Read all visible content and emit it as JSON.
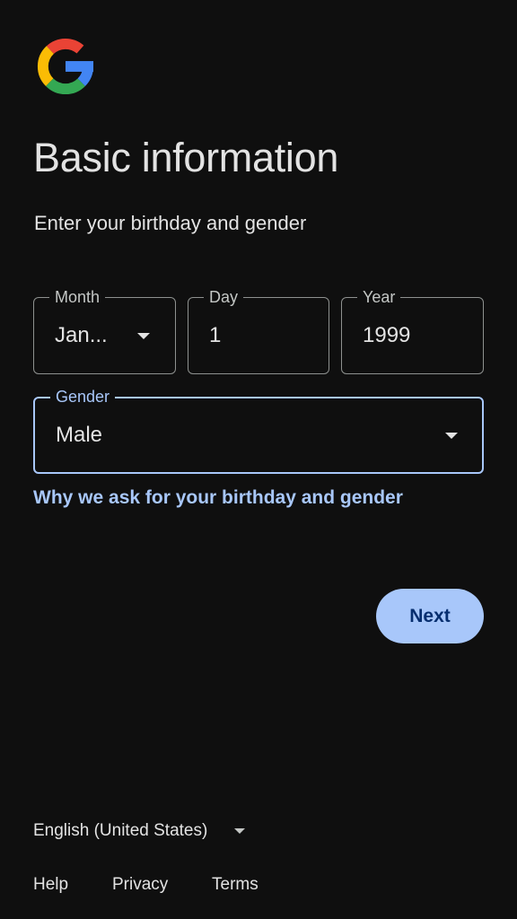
{
  "logo": {
    "icon": "google-g-icon",
    "colors": {
      "blue": "#4285F4",
      "red": "#EA4335",
      "yellow": "#FBBC05",
      "green": "#34A853"
    }
  },
  "header": {
    "title": "Basic information",
    "subtitle": "Enter your birthday and gender"
  },
  "form": {
    "month": {
      "label": "Month",
      "value": "Jan...",
      "icon": "chevron-down-icon"
    },
    "day": {
      "label": "Day",
      "value": "1"
    },
    "year": {
      "label": "Year",
      "value": "1999"
    },
    "gender": {
      "label": "Gender",
      "value": "Male",
      "icon": "chevron-down-icon"
    },
    "help_link": "Why we ask for your birthday and gender",
    "next_label": "Next"
  },
  "footer": {
    "language": "English (United States)",
    "language_icon": "chevron-down-icon",
    "links": [
      "Help",
      "Privacy",
      "Terms"
    ]
  },
  "colors": {
    "background": "#0f0f0f",
    "accent": "#a8c7fa",
    "text": "#e3e3e3",
    "outline": "#8e918f",
    "button_text": "#062e6f"
  }
}
